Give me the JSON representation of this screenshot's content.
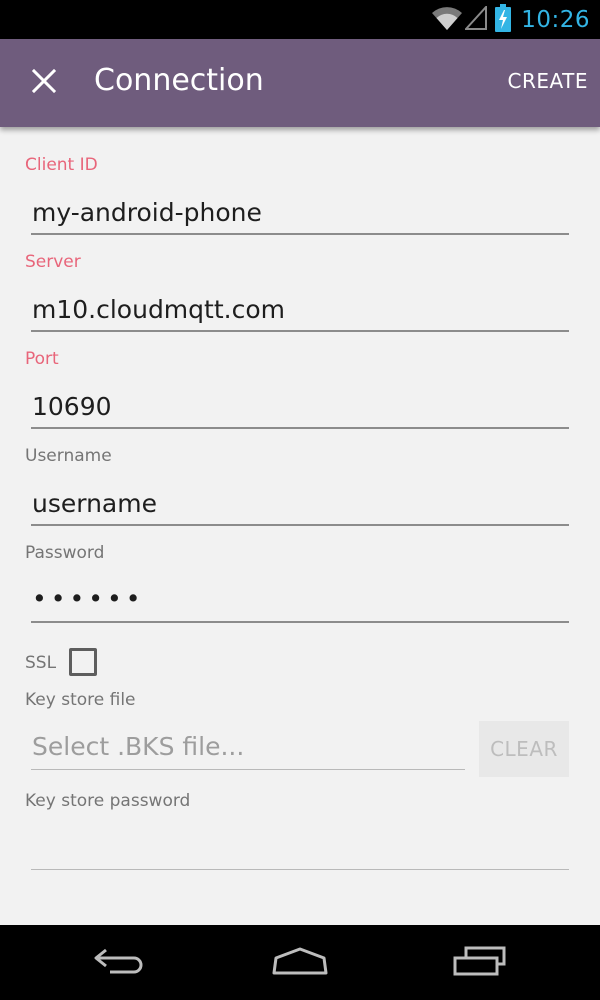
{
  "status_bar": {
    "time": "10:26",
    "icons": [
      "wifi-icon",
      "signal-icon",
      "battery-charging-icon"
    ],
    "time_color": "#33b5e5"
  },
  "action_bar": {
    "close_icon": "close-icon",
    "title": "Connection",
    "create_label": "CREATE",
    "background_color": "#6f5c7d"
  },
  "form": {
    "client_id": {
      "label": "Client ID",
      "value": "my-android-phone"
    },
    "server": {
      "label": "Server",
      "value": "m10.cloudmqtt.com"
    },
    "port": {
      "label": "Port",
      "value": "10690"
    },
    "username": {
      "label": "Username",
      "value": "username"
    },
    "password": {
      "label": "Password",
      "value": "••••••"
    },
    "ssl": {
      "label": "SSL",
      "checked": false
    },
    "key_store_file": {
      "label": "Key store file",
      "placeholder": "Select .BKS file...",
      "clear_label": "CLEAR"
    },
    "key_store_password": {
      "label": "Key store password",
      "value": ""
    },
    "accent_color": "#e8657a"
  },
  "nav_bar": {
    "buttons": [
      "back-icon",
      "home-icon",
      "recent-apps-icon"
    ]
  }
}
